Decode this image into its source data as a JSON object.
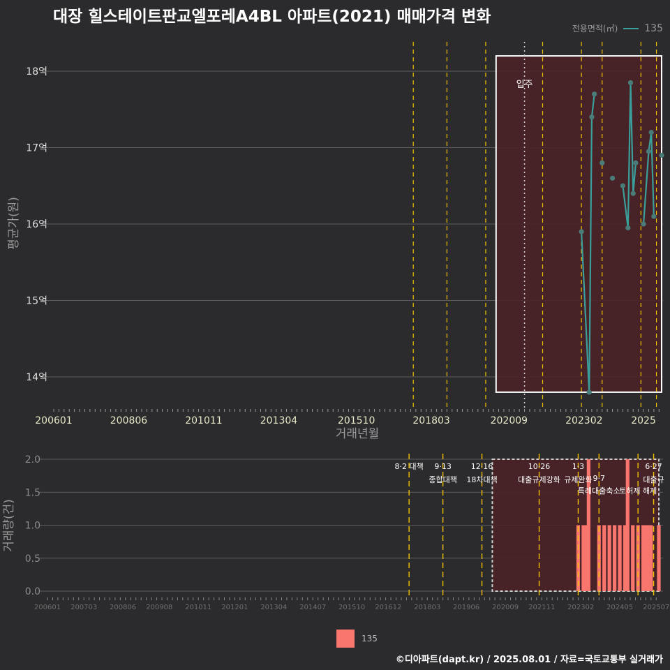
{
  "title": "대장 힐스테이트판교엘포레A4BL 아파트(2021) 매매가격 변화",
  "legend_top": {
    "title": "전용면적(㎡)",
    "label": "135"
  },
  "legend_bottom": {
    "label": "135"
  },
  "footer": "©디아파트(dapt.kr) / 2025.08.01 / 자료=국토교통부 실거래가",
  "colors": {
    "background": "#2b2b2d",
    "line": "#3a9f9a",
    "point": "#4a7d7a",
    "bar": "#f8766d",
    "highlight_fill": "#4a2227",
    "policy_line": "#f2c200",
    "grid": "#5d5d5d"
  },
  "chart_data": [
    {
      "type": "line",
      "title": "대장 힐스테이트판교엘포레A4BL 아파트(2021) 매매가격 변화",
      "xlabel": "거래년월",
      "ylabel": "평균가(원)",
      "x_range": [
        "2006-01",
        "2025-08"
      ],
      "ylim": [
        13.6,
        18.5
      ],
      "y_ticks": [
        14,
        15,
        16,
        17,
        18
      ],
      "y_tick_labels": [
        "14억",
        "15억",
        "16억",
        "17억",
        "18억"
      ],
      "x_tick_labels": [
        "200601",
        "200806",
        "201011",
        "201304",
        "201510",
        "201803",
        "202009",
        "202302",
        "2025"
      ],
      "grid": "horizontal",
      "highlight_box": {
        "x_range": [
          "2020-04",
          "2025-08"
        ],
        "y_range": [
          13.8,
          18.2
        ]
      },
      "annotation": {
        "text": "입주",
        "x": "2021-03"
      },
      "policy_dates": [
        "2017-08",
        "2018-09",
        "2019-12",
        "2021-10",
        "2023-01",
        "2023-09",
        "2024-12",
        "2025-06"
      ],
      "series": [
        {
          "name": "135",
          "points": [
            {
              "x": "2023-01",
              "y": 15.9,
              "connected": false
            },
            {
              "x": "2023-04",
              "y": 13.8,
              "connected": true
            },
            {
              "x": "2023-05",
              "y": 17.4,
              "connected": true
            },
            {
              "x": "2023-06",
              "y": 17.7,
              "connected": true
            },
            {
              "x": "2023-09",
              "y": 16.8,
              "connected": false
            },
            {
              "x": "2024-01",
              "y": 16.6,
              "connected": false
            },
            {
              "x": "2024-05",
              "y": 16.5,
              "connected": false
            },
            {
              "x": "2024-07",
              "y": 15.95,
              "connected": true
            },
            {
              "x": "2024-08",
              "y": 17.85,
              "connected": true
            },
            {
              "x": "2024-09",
              "y": 16.4,
              "connected": true
            },
            {
              "x": "2024-10",
              "y": 16.8,
              "connected": true
            },
            {
              "x": "2025-01",
              "y": 16.0,
              "connected": false
            },
            {
              "x": "2025-03",
              "y": 16.95,
              "connected": true
            },
            {
              "x": "2025-04",
              "y": 17.2,
              "connected": true
            },
            {
              "x": "2025-05",
              "y": 16.1,
              "connected": true
            },
            {
              "x": "2025-08",
              "y": 16.9,
              "connected": false
            }
          ]
        }
      ]
    },
    {
      "type": "bar",
      "ylabel": "거래량(건)",
      "x_range": [
        "2006-01",
        "2025-08"
      ],
      "ylim": [
        0,
        2
      ],
      "y_ticks": [
        0,
        0.5,
        1,
        1.5,
        2
      ],
      "y_tick_labels": [
        "0.0",
        "0.5",
        "1.0",
        "1.5",
        "2.0"
      ],
      "x_tick_labels": [
        "200601",
        "200703",
        "200806",
        "200908",
        "201011",
        "201201",
        "201304",
        "201407",
        "201510",
        "201612",
        "201803",
        "201906",
        "202009",
        "202111",
        "202302",
        "202405",
        "202507"
      ],
      "grid": "horizontal",
      "highlight_box": {
        "x_range": [
          "2020-04",
          "2025-08"
        ],
        "y_range": [
          0,
          2
        ]
      },
      "policy_events": [
        {
          "date": "2017-08",
          "line1": "8·2 대책",
          "line2": ""
        },
        {
          "date": "2018-09",
          "line1": "9·13",
          "line2": "종합대책"
        },
        {
          "date": "2019-12",
          "line1": "12·16",
          "line2": "18차대책"
        },
        {
          "date": "2021-10",
          "line1": "10·26",
          "line2": "대출규제강화"
        },
        {
          "date": "2023-01",
          "line1": "1·3",
          "line2": "규제완화"
        },
        {
          "date": "2023-09",
          "line1": "9·7",
          "line2": "특례대출축소"
        },
        {
          "date": "2024-12",
          "line1": "",
          "line2": "토허제 해제"
        },
        {
          "date": "2025-06",
          "line1": "6·27",
          "line2": "대출규"
        }
      ],
      "series": [
        {
          "name": "135",
          "bars": [
            {
              "x": "2023-01",
              "y": 1
            },
            {
              "x": "2023-03",
              "y": 1
            },
            {
              "x": "2023-04",
              "y": 1
            },
            {
              "x": "2023-05",
              "y": 2
            },
            {
              "x": "2023-09",
              "y": 1
            },
            {
              "x": "2023-11",
              "y": 1
            },
            {
              "x": "2024-01",
              "y": 1
            },
            {
              "x": "2024-03",
              "y": 1
            },
            {
              "x": "2024-05",
              "y": 1
            },
            {
              "x": "2024-07",
              "y": 1
            },
            {
              "x": "2024-08",
              "y": 2
            },
            {
              "x": "2024-10",
              "y": 1
            },
            {
              "x": "2024-12",
              "y": 1
            },
            {
              "x": "2025-02",
              "y": 1
            },
            {
              "x": "2025-03",
              "y": 1
            },
            {
              "x": "2025-04",
              "y": 1
            },
            {
              "x": "2025-05",
              "y": 1
            },
            {
              "x": "2025-08",
              "y": 1
            }
          ]
        }
      ]
    }
  ]
}
